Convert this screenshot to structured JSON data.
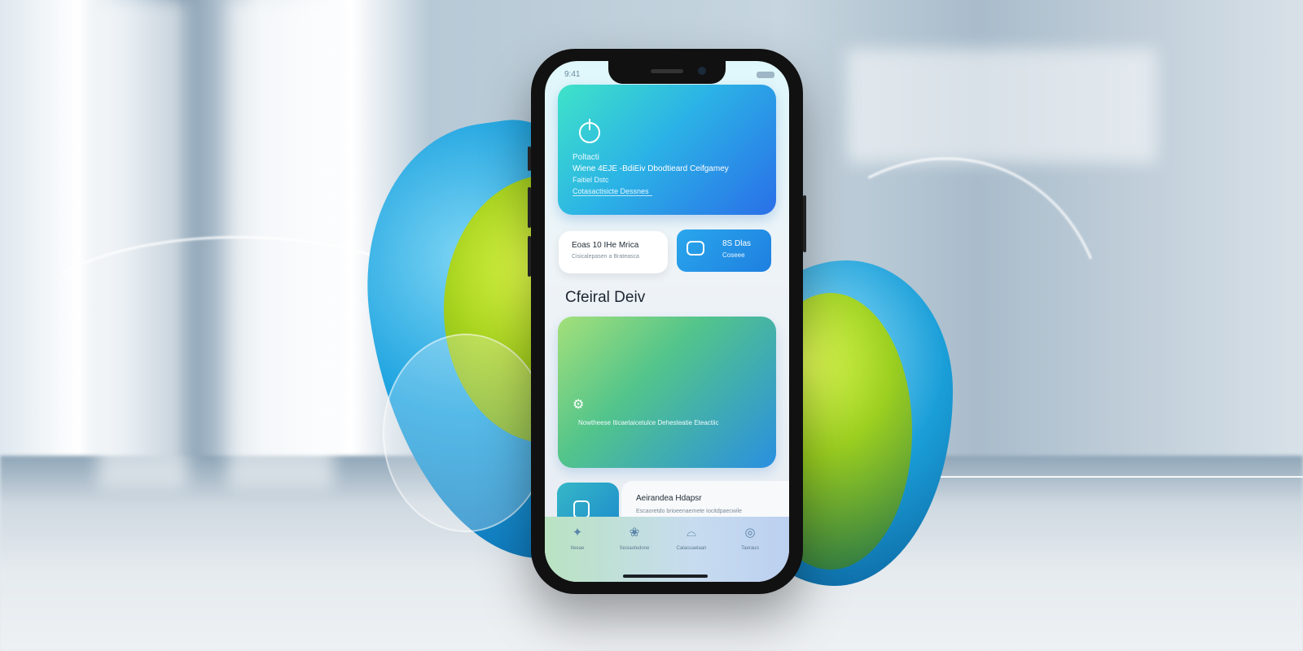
{
  "status": {
    "time": "9:41"
  },
  "hero": {
    "icon": "power-icon",
    "line1": "Poltacti",
    "line2": "Wiene 4EJE -BdiEiv Dbodtieard Ceifgamey",
    "line3": "Faitiel Dstc",
    "line4": "Cotasactisicte Dessnes"
  },
  "chips": {
    "white": {
      "title": "Eoas 10 IHe Mrica",
      "subtitle": "Cisicalepasen a Brateasca"
    },
    "blue": {
      "icon": "chat-icon",
      "title": "8S Dlas",
      "subtitle": "Coseee"
    }
  },
  "section": {
    "title": "Cfeiral Deiv"
  },
  "feature": {
    "icon": "gear-icon",
    "text": "Nowtheese Iticaetaicetulce Dehesteatie Eteactiic"
  },
  "row": {
    "icon": "document-icon",
    "title": "Aeirandea Hdapsr",
    "subtitle": "Escaoretdo brioeenaemete Iocitdpaecwile"
  },
  "tabs": [
    {
      "icon": "sparkle-icon",
      "glyph": "✦",
      "label": "Iteeae"
    },
    {
      "icon": "leaf-icon",
      "glyph": "❀",
      "label": "Sesiaotedone"
    },
    {
      "icon": "chat-bubble-icon",
      "glyph": "⌓",
      "label": "Catacuaelaan"
    },
    {
      "icon": "profile-icon",
      "glyph": "◎",
      "label": "Taerauo"
    }
  ],
  "colors": {
    "accent_blue": "#2a6fe8",
    "accent_green": "#a6d21e",
    "accent_teal": "#3fe3c8"
  }
}
